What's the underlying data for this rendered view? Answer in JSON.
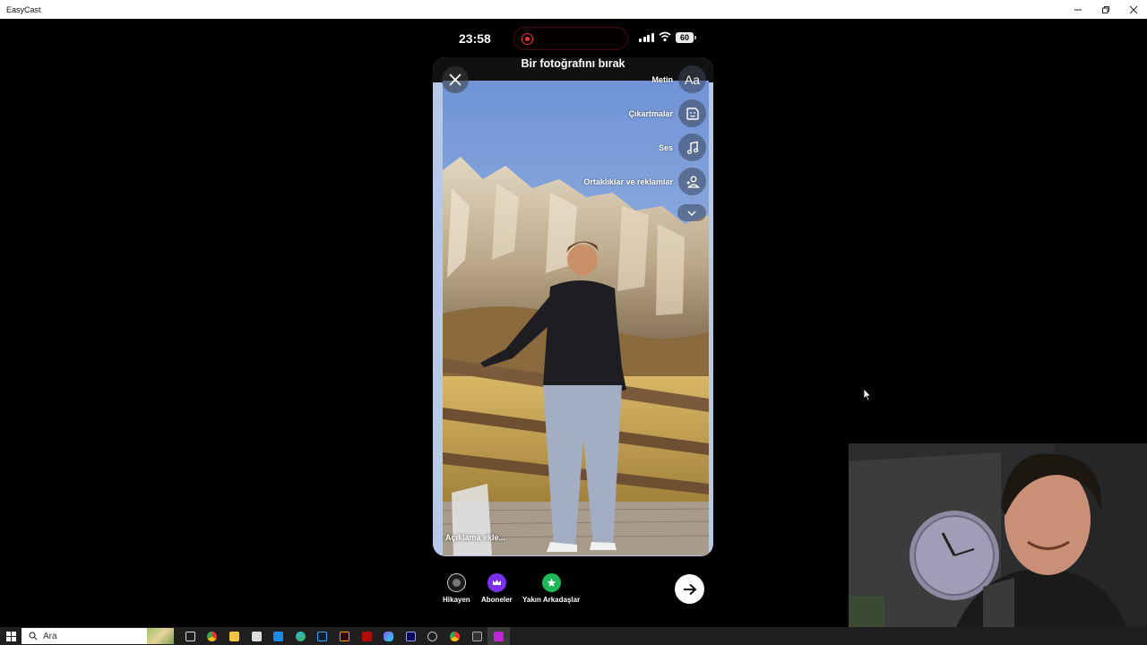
{
  "window": {
    "title": "EasyCast",
    "controls": [
      "minimize",
      "restore",
      "close"
    ]
  },
  "phone_status": {
    "time": "23:58",
    "battery": "60"
  },
  "story_editor": {
    "title": "Bir fotoğrafını bırak",
    "tools": [
      {
        "label": "Metin",
        "icon": "text-aa-icon",
        "glyph": "Aa"
      },
      {
        "label": "Çıkartmalar",
        "icon": "sticker-icon"
      },
      {
        "label": "Ses",
        "icon": "music-note-icon"
      },
      {
        "label": "Ortaklıklar ve reklamlar",
        "icon": "partnership-icon"
      }
    ],
    "caption_placeholder": "Açıklama ekle..."
  },
  "audience": [
    {
      "label": "Hikayen",
      "color": "#1c1c1c"
    },
    {
      "label": "Aboneler",
      "color": "#7b2ff2"
    },
    {
      "label": "Yakın Arkadaşlar",
      "color": "#1db954"
    }
  ],
  "taskbar": {
    "search_placeholder": "Ara"
  },
  "colors": {
    "accent_purple": "#7b2ff2",
    "close_friends_green": "#1db954",
    "record_red": "#e33333"
  }
}
